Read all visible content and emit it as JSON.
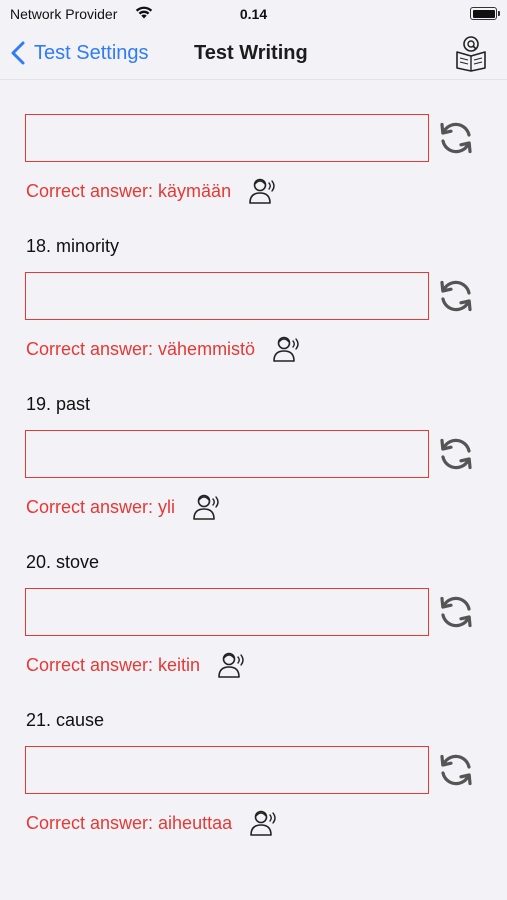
{
  "status": {
    "carrier": "Network Provider",
    "time": "0.14"
  },
  "nav": {
    "back_label": "Test Settings",
    "title": "Test Writing"
  },
  "items": [
    {
      "question": "",
      "input_value": "",
      "correct_answer": "Correct answer: käymään"
    },
    {
      "question": "18. minority",
      "input_value": "",
      "correct_answer": "Correct answer: vähemmistö"
    },
    {
      "question": "19. past",
      "input_value": "",
      "correct_answer": "Correct answer: yli"
    },
    {
      "question": "20. stove",
      "input_value": "",
      "correct_answer": "Correct answer: keitin"
    },
    {
      "question": "21. cause",
      "input_value": "",
      "correct_answer": "Correct answer: aiheuttaa"
    }
  ],
  "colors": {
    "accent": "#2f7cf6",
    "error": "#e53935",
    "background": "#f2f2f7"
  },
  "icons": [
    "wifi-icon",
    "battery-icon",
    "chevron-left-icon",
    "book-icon",
    "refresh-icon",
    "speaker-person-icon"
  ]
}
